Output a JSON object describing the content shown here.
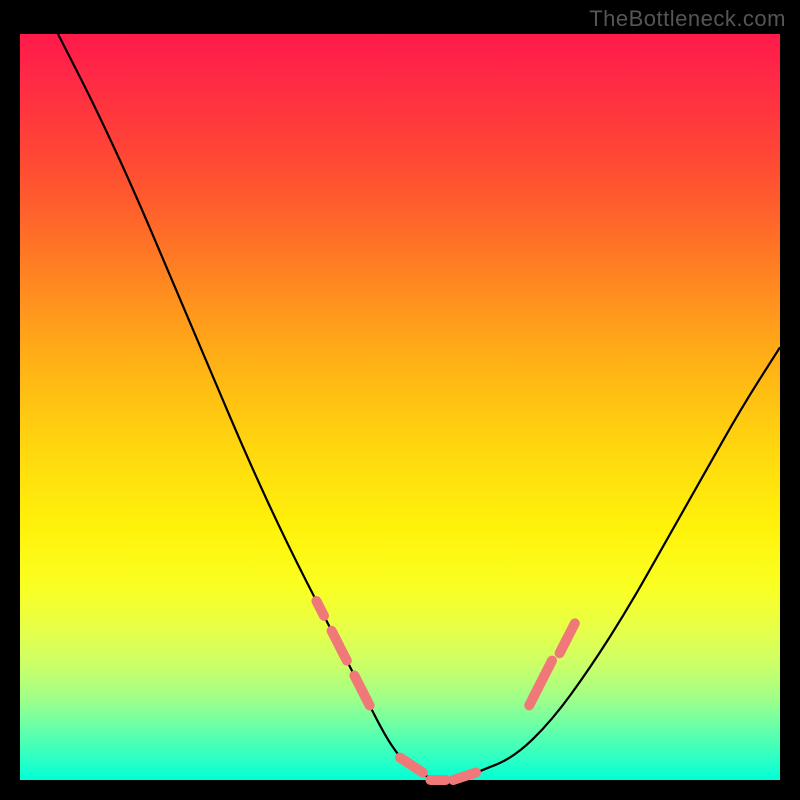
{
  "watermark": "TheBottleneck.com",
  "colors": {
    "background": "#000000",
    "gradient_top": "#ff1a4b",
    "gradient_bottom": "#00ffd4",
    "curve": "#000000",
    "marker": "#f07878"
  },
  "chart_data": {
    "type": "line",
    "title": "",
    "xlabel": "",
    "ylabel": "",
    "xlim": [
      0,
      100
    ],
    "ylim": [
      0,
      100
    ],
    "grid": false,
    "legend": false,
    "series": [
      {
        "name": "bottleneck-curve",
        "x": [
          5,
          10,
          15,
          20,
          25,
          30,
          35,
          40,
          45,
          48,
          50,
          52,
          55,
          58,
          60,
          65,
          70,
          75,
          80,
          85,
          90,
          95,
          100
        ],
        "y": [
          100,
          90,
          79,
          67,
          55,
          43,
          32,
          22,
          12,
          6,
          3,
          1,
          0,
          0,
          1,
          3,
          8,
          15,
          23,
          32,
          41,
          50,
          58
        ]
      }
    ],
    "markers": {
      "name": "highlighted-segments",
      "segments": [
        {
          "x0": 39,
          "y0": 24,
          "x1": 40,
          "y1": 22
        },
        {
          "x0": 41,
          "y0": 20,
          "x1": 43,
          "y1": 16
        },
        {
          "x0": 44,
          "y0": 14,
          "x1": 46,
          "y1": 10
        },
        {
          "x0": 50,
          "y0": 3,
          "x1": 53,
          "y1": 1
        },
        {
          "x0": 54,
          "y0": 0,
          "x1": 56,
          "y1": 0
        },
        {
          "x0": 57,
          "y0": 0,
          "x1": 60,
          "y1": 1
        },
        {
          "x0": 67,
          "y0": 10,
          "x1": 69,
          "y1": 14
        },
        {
          "x0": 69,
          "y0": 14,
          "x1": 70,
          "y1": 16
        },
        {
          "x0": 71,
          "y0": 17,
          "x1": 73,
          "y1": 21
        }
      ]
    }
  }
}
